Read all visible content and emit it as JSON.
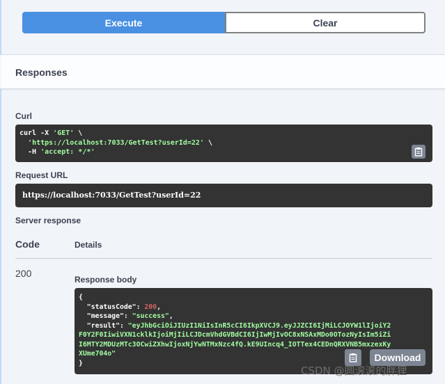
{
  "buttons": {
    "execute": "Execute",
    "clear": "Clear"
  },
  "responses": {
    "title": "Responses"
  },
  "curl": {
    "label": "Curl",
    "line1_cmd": "curl -X ",
    "line1_method": "'GET'",
    "line1_tail": " \\",
    "line2_url": "'https://localhost:7033/GetTest?userId=22'",
    "line2_tail": " \\",
    "line3_flag": "  -H ",
    "line3_header": "'accept: */*'"
  },
  "request_url": {
    "label": "Request URL",
    "value": "https://localhost:7033/GetTest?userId=22"
  },
  "server_response": {
    "label": "Server response",
    "code_header": "Code",
    "details_header": "Details",
    "status_code": "200",
    "body_label": "Response body",
    "body": {
      "open": "{",
      "k1": "  \"statusCode\": ",
      "v1": "200",
      "c1": ",",
      "k2": "  \"message\": ",
      "v2": "\"success\"",
      "c2": ",",
      "k3": "  \"result\": ",
      "v3a": "\"eyJhbGciOiJIUzI1NiIsInR5cCI6IkpXVCJ9.eyJJZCI6IjMiLCJOYW1lIjoiY2",
      "v3b": "F0Y2F0IiwiVXN1cklkIjoiMjIiLCJDcmVhdGVBdCI6IjIwMjIvOC8xNSAxMDo0OTozNyIsIm5iZi",
      "v3c": "I6MTY2MDUzMTc3OCwiZXhwIjoxNjYwNTMxNzc4fQ.kE9UIncq4_IOTTex4CEDnQRXVNB5mxzexKy",
      "v3d": "XUme704o\"",
      "close": "}"
    },
    "download_label": "Download"
  },
  "watermark": "CSDN @圆滚滚的胖狸"
}
